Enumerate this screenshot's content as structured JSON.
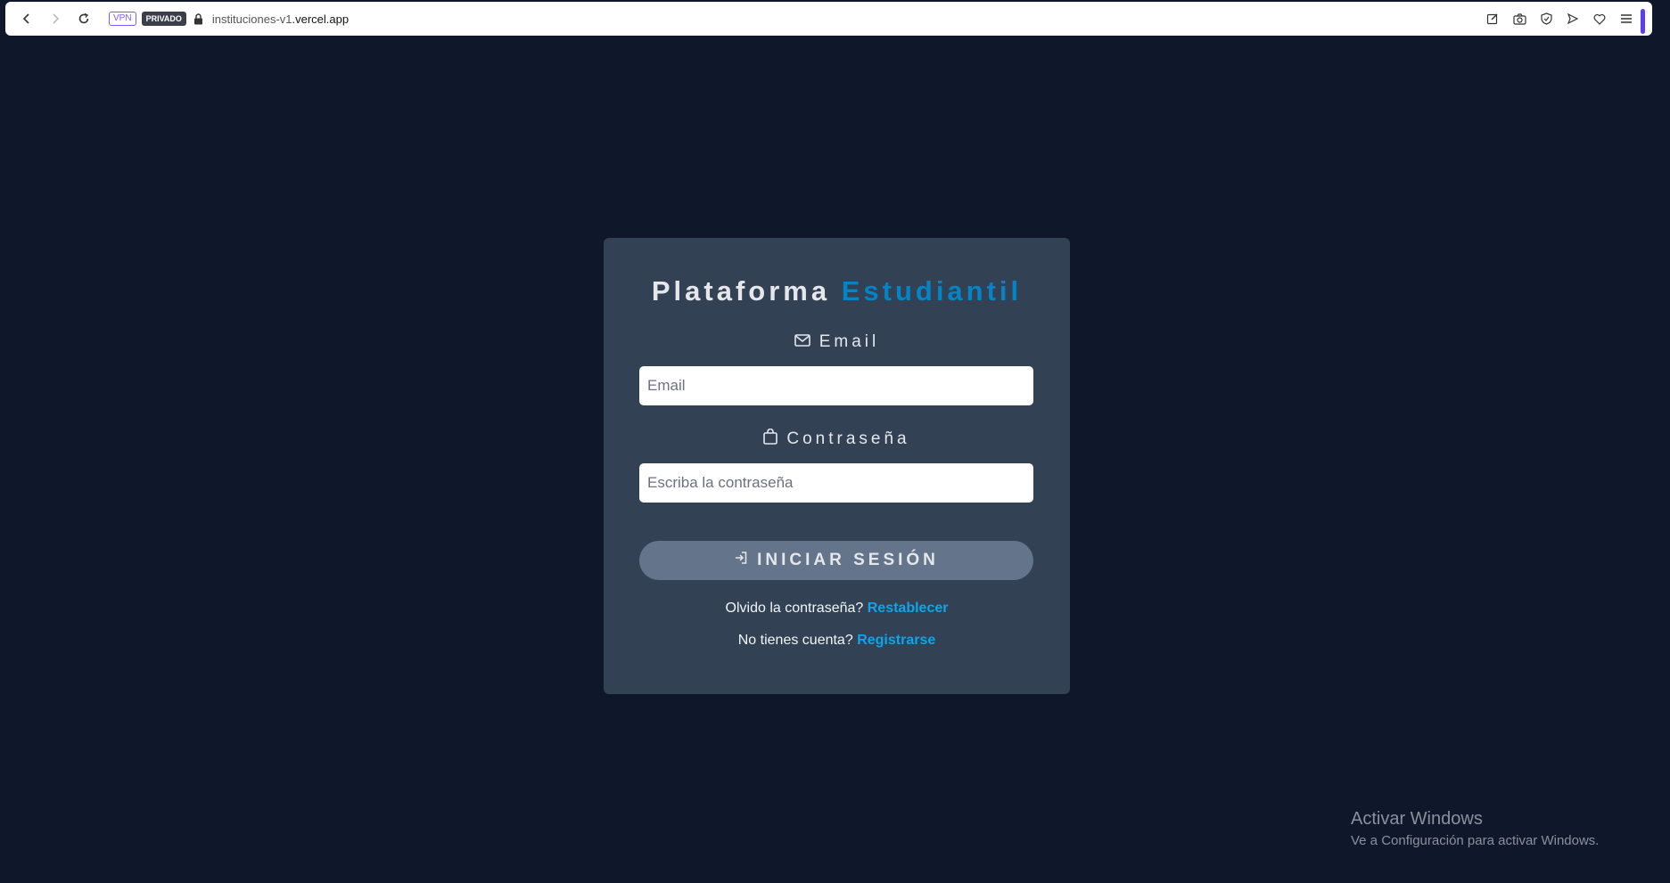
{
  "browser": {
    "vpn_badge": "VPN",
    "private_badge": "PRIVADO",
    "url_host": "instituciones-v1",
    "url_rest": ".vercel.app"
  },
  "login": {
    "title_main": "Plataforma",
    "title_accent": "Estudiantil",
    "email_label": "Email",
    "email_placeholder": "Email",
    "password_label": "Contraseña",
    "password_placeholder": "Escriba la contraseña",
    "submit_label": "INICIAR SESIÓN",
    "forgot_text": "Olvido la contraseña?",
    "forgot_link": "Restablecer",
    "register_text": "No tienes cuenta?",
    "register_link": "Registrarse"
  },
  "watermark": {
    "title": "Activar Windows",
    "subtitle": "Ve a Configuración para activar Windows."
  },
  "colors": {
    "background": "#0f172a",
    "card": "#334155",
    "accent": "#0284c7",
    "button": "#64748b"
  }
}
